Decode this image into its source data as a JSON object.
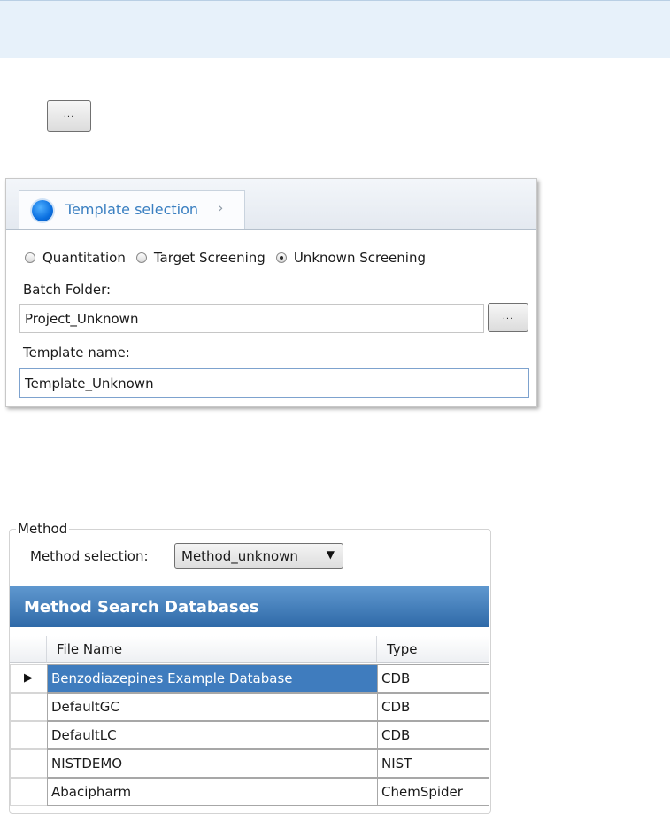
{
  "top_browse_button": {
    "label": "..."
  },
  "template_selection": {
    "step_label": "Template selection",
    "step_chevron": "›",
    "radio_options": [
      {
        "label": "Quantitation",
        "checked": false
      },
      {
        "label": "Target Screening",
        "checked": false
      },
      {
        "label": "Unknown Screening",
        "checked": true
      }
    ],
    "batch_folder_label": "Batch Folder:",
    "batch_folder_value": "Project_Unknown",
    "browse_button_label": "...",
    "template_name_label": "Template name:",
    "template_name_value": "Template_Unknown"
  },
  "method": {
    "legend": "Method",
    "selection_label": "Method selection:",
    "selection_value": "Method_unknown",
    "dropdown_arrow": "▼",
    "databases_header": "Method Search Databases",
    "columns": [
      "File Name",
      "Type"
    ],
    "current_row_marker": "▶",
    "rows": [
      {
        "file_name": "Benzodiazepines Example Database",
        "type": "CDB",
        "selected": true
      },
      {
        "file_name": "DefaultGC",
        "type": "CDB",
        "selected": false
      },
      {
        "file_name": "DefaultLC",
        "type": "CDB",
        "selected": false
      },
      {
        "file_name": "NISTDEMO",
        "type": "NIST",
        "selected": false
      },
      {
        "file_name": "Abacipharm",
        "type": "ChemSpider",
        "selected": false
      }
    ]
  },
  "colors": {
    "step_active": "#0a6fe0",
    "step_label": "#3a7fc1",
    "db_header": "#2f6aa8",
    "selected_row": "#3f7cbe"
  }
}
